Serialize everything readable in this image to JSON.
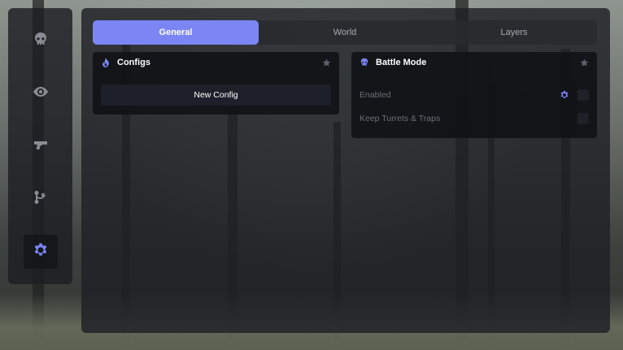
{
  "sidebar": {
    "items": [
      {
        "icon": "skull-icon",
        "name": "sidebar-item-combat"
      },
      {
        "icon": "eye-icon",
        "name": "sidebar-item-visuals"
      },
      {
        "icon": "gun-icon",
        "name": "sidebar-item-weapons"
      },
      {
        "icon": "branch-icon",
        "name": "sidebar-item-misc"
      },
      {
        "icon": "gear-icon",
        "name": "sidebar-item-settings",
        "active": true
      }
    ]
  },
  "tabs": [
    {
      "label": "General",
      "active": true
    },
    {
      "label": "World"
    },
    {
      "label": "Layers"
    }
  ],
  "configs_panel": {
    "title": "Configs",
    "new_config_label": "New Config"
  },
  "battle_panel": {
    "title": "Battle Mode",
    "options": [
      {
        "label": "Enabled",
        "has_settings": true,
        "checked": false
      },
      {
        "label": "Keep Turrets & Traps",
        "has_settings": false,
        "checked": false
      }
    ]
  },
  "colors": {
    "accent": "#7c85f4",
    "panel": "#111216",
    "muted_text": "#6c6f78"
  }
}
